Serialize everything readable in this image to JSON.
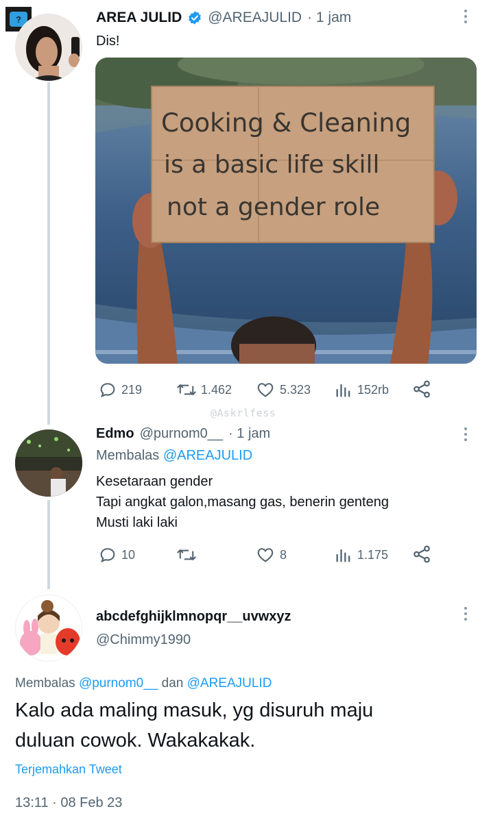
{
  "watermark": "@Askrlfess",
  "tweet1": {
    "name": "AREA JULID",
    "handle": "@AREAJULID",
    "time": "· 1 jam",
    "text": "Dis!",
    "sign_lines": [
      "Cooking & Cleaning",
      "is a basic life skill",
      "not a gender role"
    ],
    "replies": "219",
    "retweets": "1.462",
    "likes": "5.323",
    "views": "152rb"
  },
  "tweet2": {
    "name": "Edmo",
    "handle": "@purnom0__",
    "time": "· 1 jam",
    "reply_prefix": "Membalas",
    "reply_to": "@AREAJULID",
    "lines": [
      "Kesetaraan gender",
      "Tapi angkat galon,masang gas, benerin genteng",
      "Musti laki laki"
    ],
    "replies": "10",
    "retweets": "",
    "likes": "8",
    "views": "1.175"
  },
  "tweet3": {
    "name": "abcdefghijklmnopqr__uvwxyz",
    "handle": "@Chimmy1990",
    "reply_prefix": "Membalas",
    "reply_to_1": "@purnom0__",
    "reply_and": "dan",
    "reply_to_2": "@AREAJULID",
    "text_line1": "Kalo ada maling masuk, yg disuruh maju",
    "text_line2": "duluan cowok. Wakakakak.",
    "translate": "Terjemahkan Tweet",
    "timestamp": "13:11 · 08 Feb 23"
  },
  "colors": {
    "accent": "#1d9bf0",
    "muted": "#536471",
    "verified": "#1d9bf0",
    "thread_line": "#cfd9de"
  }
}
